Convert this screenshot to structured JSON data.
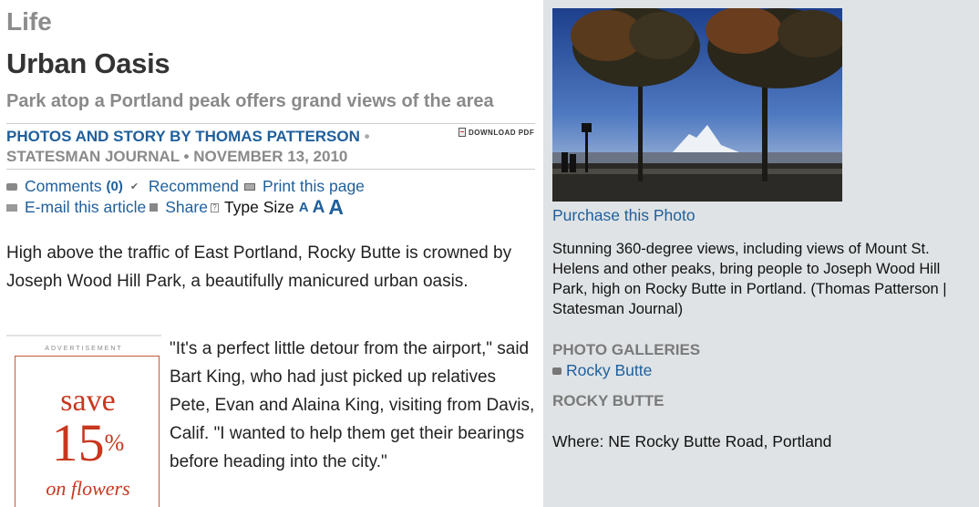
{
  "article": {
    "section": "Life",
    "headline": "Urban Oasis",
    "subhead": "Park atop a Portland peak offers grand views of the area",
    "byline_author": "PHOTOS AND STORY BY THOMAS PATTERSON",
    "byline_pub": "STATESMAN JOURNAL • NOVEMBER 13, 2010",
    "download_pdf": "DOWNLOAD PDF",
    "lead": "High above the traffic of East Portland, Rocky Butte is crowned by Joseph Wood Hill Park, a beautifully manicured urban oasis.",
    "body": "\"It's a perfect little detour from the airport,\" said Bart King, who had just picked up relatives Pete, Evan and Alaina King, visiting from Davis, Calif. \"I wanted to help them get their bearings before heading into the city.\""
  },
  "tools": {
    "comments": "Comments",
    "comments_count": "(0)",
    "recommend": "Recommend",
    "print": "Print this page",
    "email": "E-mail this article",
    "share": "Share",
    "type_size": "Type Size",
    "a_small": "A",
    "a_medium": "A",
    "a_large": "A"
  },
  "ad": {
    "label": "ADVERTISEMENT",
    "save": "save",
    "percent": "15",
    "percent_sign": "%",
    "on_flowers": "on flowers"
  },
  "sidebar": {
    "purchase": "Purchase this Photo",
    "caption": "Stunning 360-degree views, including views of Mount St. Helens and other peaks, bring people to Joseph Wood Hill Park, high on Rocky Butte in Portland. (Thomas Patterson | Statesman Journal)",
    "galleries_heading": "PHOTO GALLERIES",
    "gallery_link": "Rocky Butte",
    "info_heading": "ROCKY BUTTE",
    "where": "Where: NE Rocky Butte Road, Portland"
  },
  "colors": {
    "link": "#1f5f9c",
    "sidebar_bg": "#dfe3e5",
    "ad_red": "#c8371e"
  }
}
